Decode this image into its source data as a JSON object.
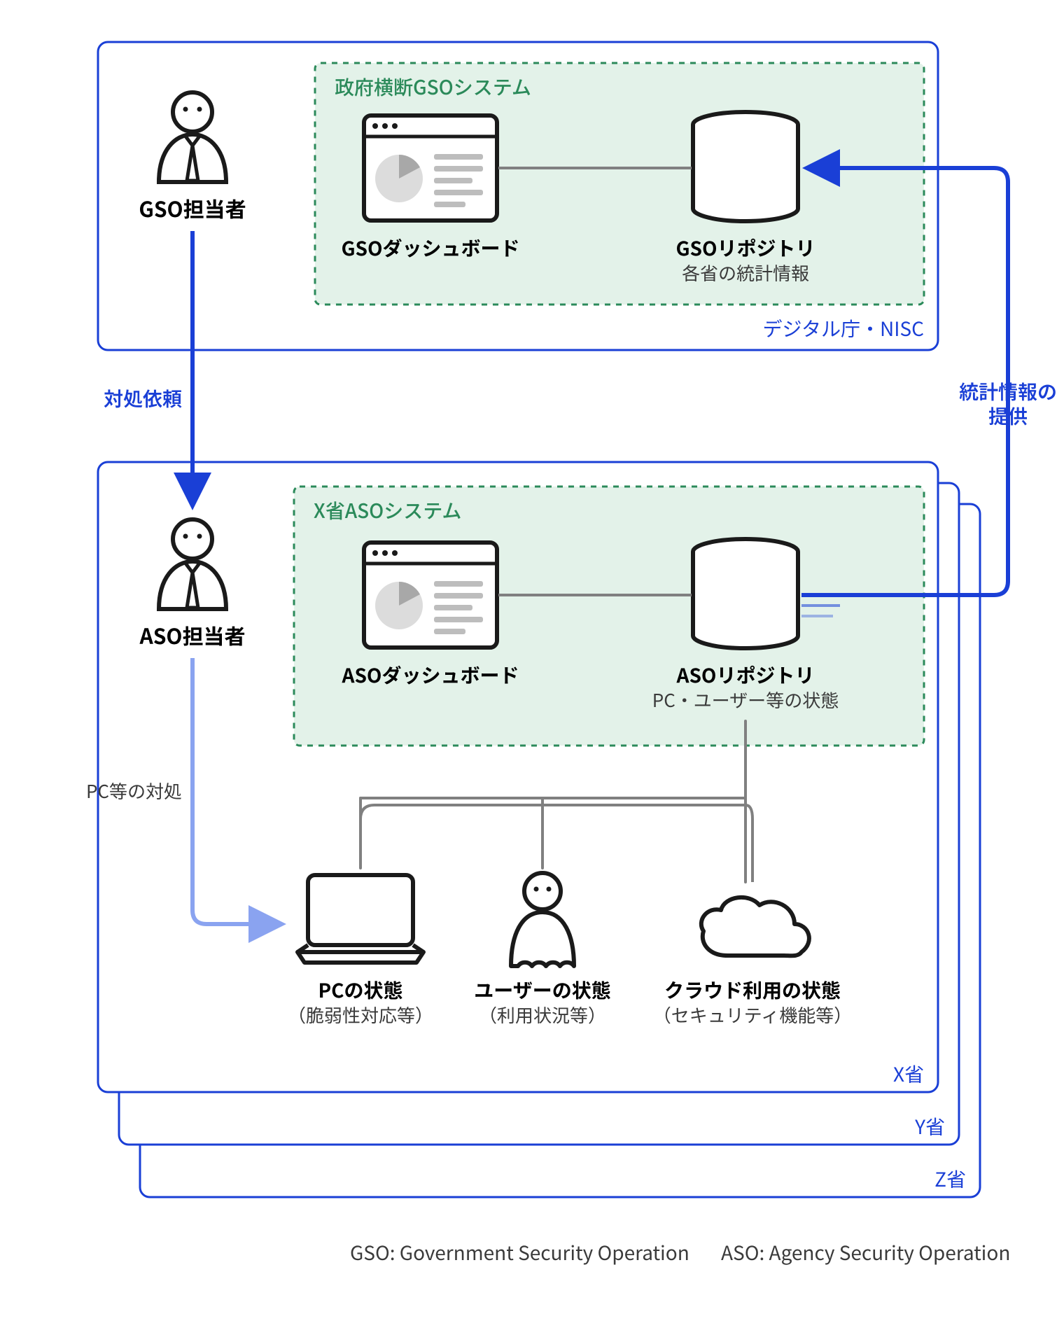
{
  "top_box": {
    "org_label": "デジタル庁・NISC",
    "gso_person": "GSO担当者",
    "gso_system_title": "政府横断GSOシステム",
    "gso_dashboard": "GSOダッシュボード",
    "gso_repo_title": "GSOリポジトリ",
    "gso_repo_sub": "各省の統計情報"
  },
  "arrows": {
    "request": "対処依頼",
    "pc_action": "PC等の対処",
    "stats_line1": "統計情報の",
    "stats_line2": "提供"
  },
  "mid_box": {
    "org_x": "X省",
    "org_y": "Y省",
    "org_z": "Z省",
    "aso_person": "ASO担当者",
    "aso_system_title": "X省ASOシステム",
    "aso_dashboard": "ASOダッシュボード",
    "aso_repo_title": "ASOリポジトリ",
    "aso_repo_sub": "PC・ユーザー等の状態"
  },
  "assets": {
    "pc_title": "PCの状態",
    "pc_sub": "（脆弱性対応等）",
    "user_title": "ユーザーの状態",
    "user_sub": "（利用状況等）",
    "cloud_title": "クラウド利用の状態",
    "cloud_sub": "（セキュリティ機能等）"
  },
  "legend": {
    "gso": "GSO: Government Security Operation",
    "aso": "ASO: Agency Security Operation"
  },
  "colors": {
    "blue": "#1a3fd6",
    "medblue": "#3a57e0",
    "lightblue": "#8aa3f0",
    "green_stroke": "#2b8a5a",
    "green_fill": "#e3f2e9",
    "black": "#1a1a1a",
    "gray": "#707070",
    "lightgray": "#bdbdbd"
  }
}
